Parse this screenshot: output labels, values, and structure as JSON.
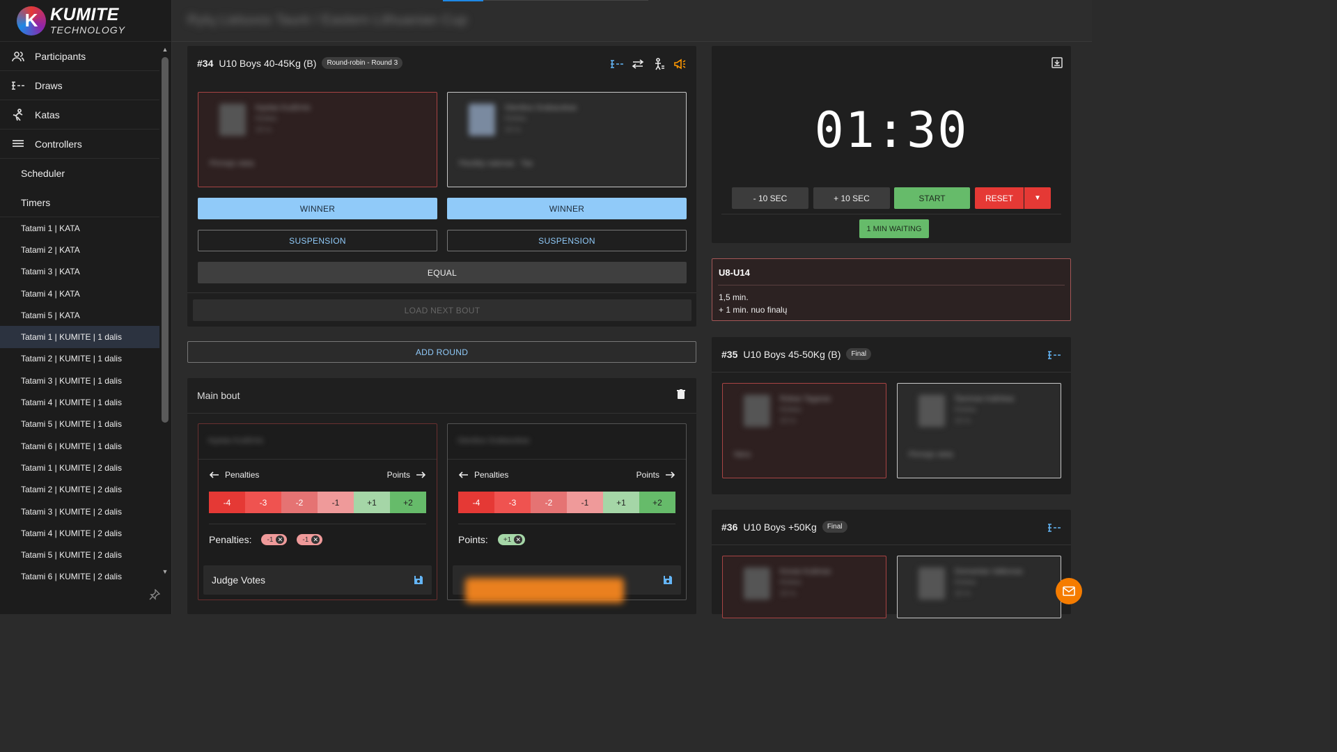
{
  "brand": {
    "name": "KUMITE",
    "sub": "TECHNOLOGY",
    "mark": "K"
  },
  "topbar": {
    "title": "Rytų Lietuvos Taurė / Eastern Lithuanian Cup"
  },
  "sidebar": {
    "nav": [
      {
        "label": "Participants",
        "icon": "participants-icon"
      },
      {
        "label": "Draws",
        "icon": "draws-icon"
      },
      {
        "label": "Katas",
        "icon": "katas-icon"
      },
      {
        "label": "Controllers",
        "icon": "controllers-icon"
      }
    ],
    "sub": [
      "Scheduler",
      "Timers"
    ],
    "tatamis": [
      "Tatami 1 | KATA",
      "Tatami 2 | KATA",
      "Tatami 3 | KATA",
      "Tatami 4 | KATA",
      "Tatami 5 | KATA",
      "Tatami 1 | KUMITE | 1 dalis",
      "Tatami 2 | KUMITE | 1 dalis",
      "Tatami 3 | KUMITE | 1 dalis",
      "Tatami 4 | KUMITE | 1 dalis",
      "Tatami 5 | KUMITE | 1 dalis",
      "Tatami 6 | KUMITE | 1 dalis",
      "Tatami 1 | KUMITE | 2 dalis",
      "Tatami 2 | KUMITE | 2 dalis",
      "Tatami 3 | KUMITE | 2 dalis",
      "Tatami 4 | KUMITE | 2 dalis",
      "Tatami 5 | KUMITE | 2 dalis",
      "Tatami 6 | KUMITE | 2 dalis"
    ],
    "active_index": 5
  },
  "bout34": {
    "num": "#34",
    "title": "U10 Boys 40-45Kg (B)",
    "chip": "Round-robin - Round 3",
    "red": {
      "name": "Kęstas Kudžmis",
      "club": "Klubas",
      "age": "10 m.",
      "note": "Pirmojo vieta"
    },
    "white": {
      "name": "Gierdius Grabauskas",
      "club": "Klubas",
      "age": "10 m.",
      "note": "Flexibly natonas · Tas"
    },
    "winner": "WINNER",
    "suspension": "SUSPENSION",
    "equal": "EQUAL",
    "load_next": "LOAD NEXT BOUT"
  },
  "add_round": "ADD ROUND",
  "main_bout": {
    "title": "Main bout",
    "red_name": "Kęstas Kudžmis",
    "white_name": "Gierdius Grabauskas",
    "penalties_label": "Penalties",
    "points_label": "Points",
    "scores": [
      "-4",
      "-3",
      "-2",
      "-1",
      "+1",
      "+2"
    ],
    "red_summary_label": "Penalties:",
    "red_tags": [
      "-1",
      "-1"
    ],
    "white_summary_label": "Points:",
    "white_tags": [
      "+1"
    ],
    "judge_votes": "Judge Votes"
  },
  "timer": {
    "time": "01:30",
    "minus": "- 10 SEC",
    "plus": "+ 10 SEC",
    "start": "START",
    "reset": "RESET",
    "waiting": "1 MIN WAITING"
  },
  "info": {
    "title": "U8-U14",
    "line1": "1,5 min.",
    "line2": "+ 1 min. nuo finalų"
  },
  "bout35": {
    "num": "#35",
    "title": "U10 Boys 45-50Kg (B)",
    "chip": "Final",
    "red": {
      "name": "Rokas Tagaras",
      "club": "Klubas",
      "age": "10 m.",
      "note": "Nėra"
    },
    "white": {
      "name": "Šarūnas Kalinkas",
      "club": "Klubas",
      "age": "10 m.",
      "note": "Pirmojo vieta"
    }
  },
  "bout36": {
    "num": "#36",
    "title": "U10 Boys +50Kg",
    "chip": "Final",
    "red": {
      "name": "Kovas Kubinas",
      "club": "Klubas",
      "age": "10 m."
    },
    "white": {
      "name": "Domantas Valkonas",
      "club": "Klubas",
      "age": "10 m."
    }
  },
  "colors": {
    "accent": "#90caf9",
    "red": "#e53935",
    "green": "#66bb6a",
    "orange": "#f57c00"
  }
}
